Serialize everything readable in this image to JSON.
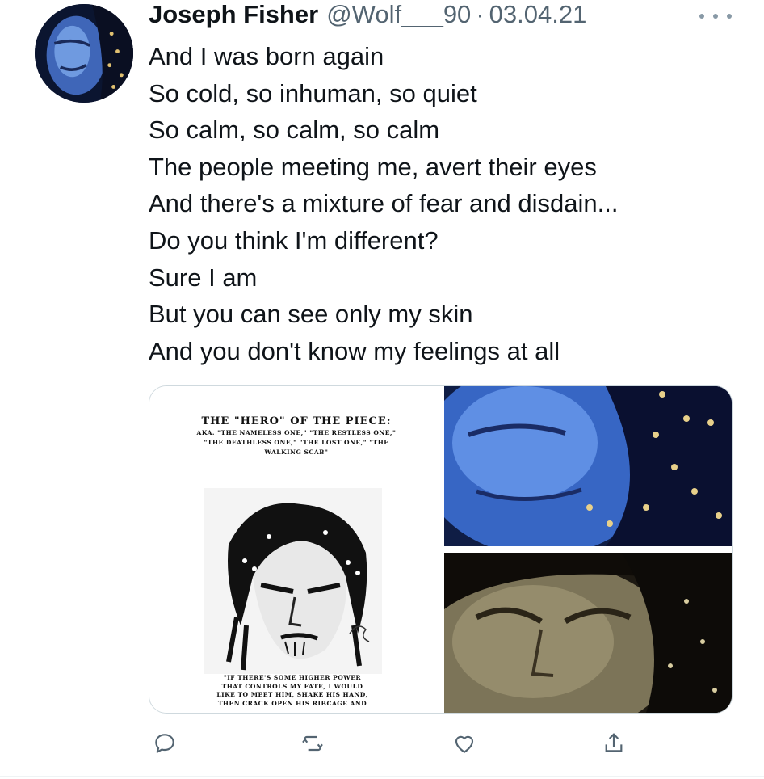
{
  "tweet": {
    "author": {
      "display_name": "Joseph Fisher",
      "handle": "@Wolf___90",
      "avatar_icon": "avatar-portrait"
    },
    "separator": "·",
    "date": "03.04.21",
    "more_icon": "more-horizontal-icon",
    "text_lines": [
      "And I was born again",
      "So cold, so inhuman, so quiet",
      "So calm, so calm, so calm",
      "The people meeting me, avert their eyes",
      "And there's a mixture of fear and disdain...",
      "Do you think I'm different?",
      "Sure I am",
      "But you can see only my skin",
      "And you don't know my feelings at all"
    ],
    "media": {
      "poster": {
        "title": "THE \"HERO\" OF THE PIECE:",
        "subtitle_lines": [
          "AKA. \"THE NAMELESS ONE,\" \"THE RESTLESS ONE,\"",
          "\"THE DEATHLESS ONE,\" \"THE LOST ONE,\" \"THE",
          "WALKING SCAB\""
        ],
        "quote_lines": [
          "\"IF THERE'S SOME HIGHER POWER",
          "THAT CONTROLS MY FATE, I WOULD",
          "LIKE TO MEET HIM, SHAKE HIS HAND,",
          "THEN CRACK OPEN HIS RIBCAGE AND"
        ]
      }
    },
    "actions": {
      "reply_icon": "reply-icon",
      "retweet_icon": "retweet-icon",
      "like_icon": "heart-icon",
      "share_icon": "share-icon"
    },
    "colors": {
      "text": "#0f1419",
      "secondary": "#536471",
      "icon": "#536471"
    }
  }
}
